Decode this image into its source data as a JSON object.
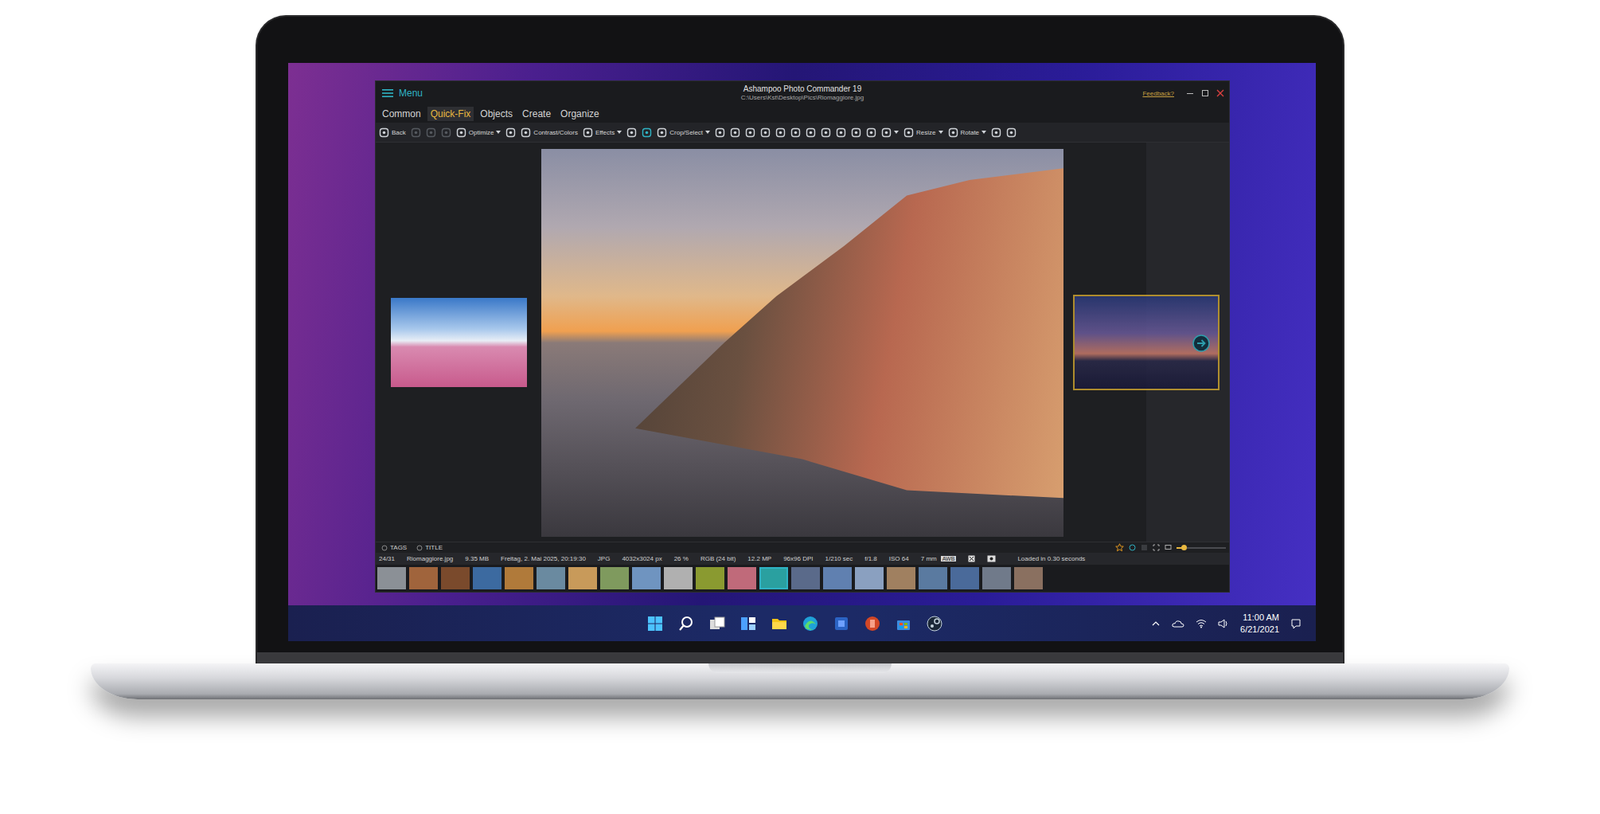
{
  "window": {
    "title": "Ashampoo Photo Commander 19",
    "path": "C:\\Users\\Kst\\Desktop\\Pics\\Riomaggiore.jpg",
    "menu": "Menu",
    "feedback": "Feedback?"
  },
  "tabs": [
    {
      "label": "Common",
      "selected": false
    },
    {
      "label": "Quick-Fix",
      "selected": true
    },
    {
      "label": "Objects",
      "selected": false
    },
    {
      "label": "Create",
      "selected": false
    },
    {
      "label": "Organize",
      "selected": false
    }
  ],
  "toolbar": [
    {
      "kind": "button",
      "label": "Back",
      "dropdown": false,
      "disabled": false,
      "active": false
    },
    {
      "kind": "icon",
      "dropdown": false,
      "disabled": true,
      "active": false
    },
    {
      "kind": "icon",
      "dropdown": false,
      "disabled": true,
      "active": false
    },
    {
      "kind": "icon",
      "dropdown": false,
      "disabled": true,
      "active": false
    },
    {
      "kind": "button",
      "label": "Optimize",
      "dropdown": true,
      "disabled": false,
      "active": false
    },
    {
      "kind": "icon",
      "dropdown": false,
      "disabled": false,
      "active": false
    },
    {
      "kind": "button",
      "label": "Contrast/Colors",
      "dropdown": false,
      "disabled": false,
      "active": false
    },
    {
      "kind": "button",
      "label": "Effects",
      "dropdown": true,
      "disabled": false,
      "active": false
    },
    {
      "kind": "icon",
      "dropdown": false,
      "disabled": false,
      "active": false
    },
    {
      "kind": "icon",
      "dropdown": false,
      "disabled": false,
      "active": true
    },
    {
      "kind": "button",
      "label": "Crop/Select",
      "dropdown": true,
      "disabled": false,
      "active": false
    },
    {
      "kind": "icon",
      "dropdown": false,
      "disabled": false,
      "active": false
    },
    {
      "kind": "icon",
      "dropdown": false,
      "disabled": false,
      "active": false
    },
    {
      "kind": "icon",
      "dropdown": false,
      "disabled": false,
      "active": false
    },
    {
      "kind": "icon",
      "dropdown": false,
      "disabled": false,
      "active": false
    },
    {
      "kind": "icon",
      "dropdown": false,
      "disabled": false,
      "active": false
    },
    {
      "kind": "icon",
      "dropdown": false,
      "disabled": false,
      "active": false
    },
    {
      "kind": "icon",
      "dropdown": false,
      "disabled": false,
      "active": false
    },
    {
      "kind": "icon",
      "dropdown": false,
      "disabled": false,
      "active": false
    },
    {
      "kind": "icon",
      "dropdown": false,
      "disabled": false,
      "active": false
    },
    {
      "kind": "icon",
      "dropdown": false,
      "disabled": false,
      "active": false
    },
    {
      "kind": "icon",
      "dropdown": false,
      "disabled": false,
      "active": false
    },
    {
      "kind": "icon",
      "dropdown": true,
      "disabled": false,
      "active": false
    },
    {
      "kind": "button",
      "label": "Resize",
      "dropdown": true,
      "disabled": false,
      "active": false
    },
    {
      "kind": "button",
      "label": "Rotate",
      "dropdown": true,
      "disabled": false,
      "active": false
    },
    {
      "kind": "icon",
      "dropdown": false,
      "disabled": false,
      "active": false
    },
    {
      "kind": "icon",
      "dropdown": false,
      "disabled": false,
      "active": false
    }
  ],
  "viewer": {
    "previous_selected": false,
    "next_selected": true
  },
  "info_tabs": [
    {
      "label": "TAGS",
      "selected": false
    },
    {
      "label": "TITLE",
      "selected": false
    }
  ],
  "favorite": {
    "on": false
  },
  "zoom_slider": {
    "level": 0.15
  },
  "status_bar": {
    "fields": [
      "24/31",
      "Riomaggiore.jpg",
      "9.35 MB",
      "Freitag, 2. Mai 2025, 20:19:30",
      "JPG",
      "4032x3024 px",
      "26 %",
      "RGB (24 bit)",
      "12.2 MP",
      "96x96 DPI",
      "1/210 sec",
      "f/1.8",
      "ISO 64",
      "7 mm"
    ],
    "badge": "AWB",
    "load_time": "Loaded in 0.30 seconds"
  },
  "filmstrip": [
    {
      "color": "#8b9096",
      "selected": false
    },
    {
      "color": "#a0643c",
      "selected": false
    },
    {
      "color": "#7a4a2c",
      "selected": false
    },
    {
      "color": "#3c6aa0",
      "selected": false
    },
    {
      "color": "#b07a3a",
      "selected": false
    },
    {
      "color": "#6a8aa0",
      "selected": false
    },
    {
      "color": "#c89a5a",
      "selected": false
    },
    {
      "color": "#7f9a5e",
      "selected": false
    },
    {
      "color": "#6f94c0",
      "selected": false
    },
    {
      "color": "#b0b0b0",
      "selected": false
    },
    {
      "color": "#8a9a30",
      "selected": false
    },
    {
      "color": "#c06a7a",
      "selected": false
    },
    {
      "color": "#2aa0a0",
      "selected": true
    },
    {
      "color": "#5a6a8a",
      "selected": false
    },
    {
      "color": "#6080b0",
      "selected": false
    },
    {
      "color": "#8aa0c0",
      "selected": false
    },
    {
      "color": "#a08060",
      "selected": false
    },
    {
      "color": "#5a7aa0",
      "selected": false
    },
    {
      "color": "#4a6a9a",
      "selected": false
    },
    {
      "color": "#707a8a",
      "selected": false
    },
    {
      "color": "#8a7060",
      "selected": false
    }
  ],
  "taskbar": {
    "time": "11:00 AM",
    "date": "6/21/2021"
  }
}
